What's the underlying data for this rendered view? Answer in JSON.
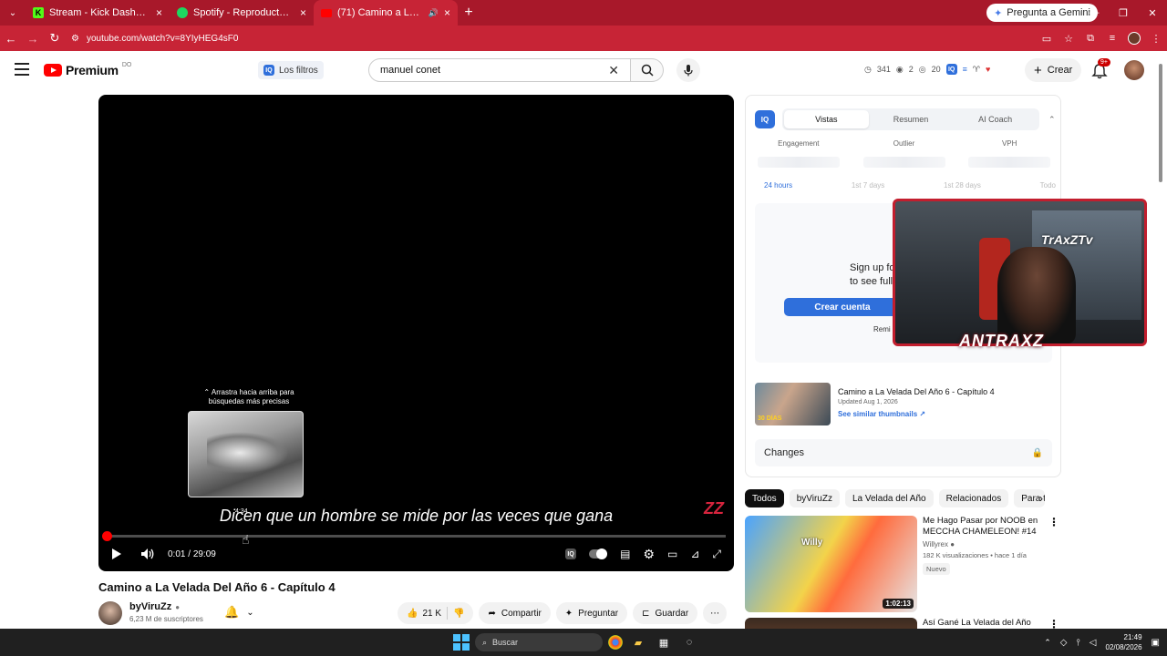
{
  "browser": {
    "tabs": [
      {
        "title": "Stream - Kick Dashboard",
        "icon": "kick-icon",
        "active": false
      },
      {
        "title": "Spotify - Reproductor web: mú",
        "icon": "spotify-icon",
        "active": false
      },
      {
        "title": "(71) Camino a La Velada De",
        "icon": "youtube-icon",
        "active": true
      }
    ],
    "gemini_label": "Pregunta a Gemini",
    "url": "youtube.com/watch?v=8YIyHEG4sF0"
  },
  "header": {
    "logo_text": "Premium",
    "logo_sup": "DO",
    "filters_label": "Los filtros",
    "search_value": "manuel conet",
    "stats": {
      "views": "341",
      "count2": "2",
      "count3": "20"
    },
    "create_label": "Crear",
    "notif_count": "9+"
  },
  "player": {
    "drag_hint_line1": "⌃ Arrastra hacia arriba para",
    "drag_hint_line2": "búsquedas más precisas",
    "preview_time": "4:34",
    "subtitle": "Dicen que un hombre se mide por las veces que gana",
    "time_current": "0:01",
    "time_total": "29:09",
    "progress": 0.002,
    "hover_pos": 0.228
  },
  "video": {
    "title": "Camino a La Velada Del Año 6 - Capítulo 4",
    "channel": "byViruZz",
    "subs": "6,23 M de suscriptores",
    "likes": "21 K",
    "share_label": "Compartir",
    "ask_label": "Preguntar",
    "save_label": "Guardar"
  },
  "ext": {
    "logo": "IQ",
    "tabs": [
      "Vistas",
      "Resumen",
      "AI Coach"
    ],
    "active_tab": 0,
    "metrics": [
      "Engagement",
      "Outlier",
      "VPH"
    ],
    "ranges": [
      "24 hours",
      "1st 7 days",
      "1st 28 days",
      "Todo"
    ],
    "signup_line1": "Sign up fo",
    "signup_line2": "to see full",
    "crear_cuenta": "Crear cuenta",
    "remi": "Remi",
    "card_title": "Camino a La Velada Del Año 6 - Capítulo 4",
    "card_date": "Updated Aug 1, 2026",
    "card_link": "See similar thumbnails ↗",
    "card_thumb_label": "30 DÍAS",
    "changes": "Changes"
  },
  "overlay": {
    "banner": "ANTRAXZ",
    "logo": "TrAxZTv"
  },
  "chips": [
    "Todos",
    "byViruZz",
    "La Velada del Año",
    "Relacionados",
    "Para ti"
  ],
  "recommendations": [
    {
      "title": "Me Hago Pasar por NOOB en MECCHA CHAMELEON! #14",
      "channel": "Willyrex",
      "views": "182 K visualizaciones • hace 1 día",
      "badge": "Nuevo",
      "duration": "1:02:13",
      "thumb_text": "Willy"
    },
    {
      "title": "Así Gané La Velada del Año",
      "channel": "",
      "views": "",
      "badge": "",
      "duration": "",
      "thumb_text": ""
    }
  ],
  "taskbar": {
    "search_placeholder": "Buscar",
    "time": "21:49",
    "date": "02/08/2026"
  },
  "colors": {
    "chrome": "#a8182a",
    "chrome_active": "#c72436",
    "accent_blue": "#2f6fdb",
    "yt_red": "#ff0000"
  }
}
